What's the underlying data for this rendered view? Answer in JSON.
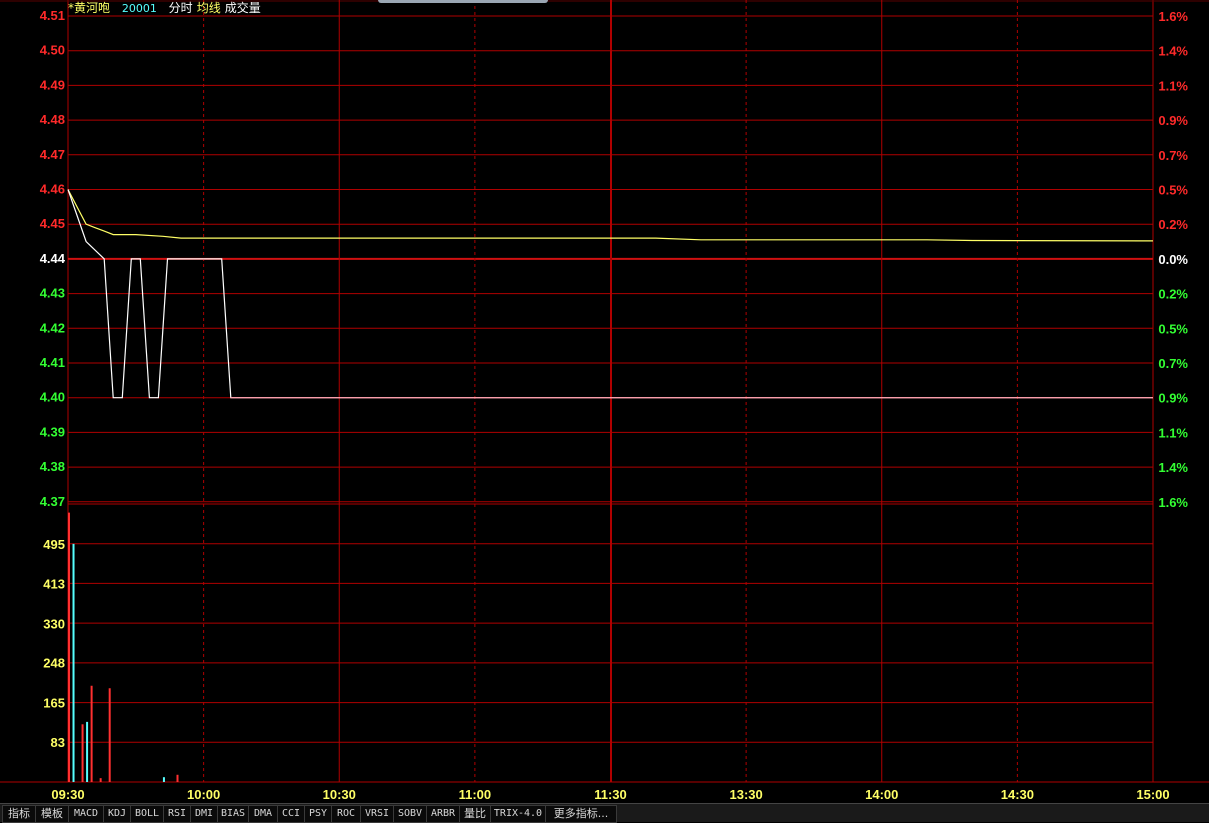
{
  "header": {
    "stock_name": "*黄河咆",
    "code": "20001",
    "legend_minute": "分时",
    "legend_avg": "均线",
    "legend_volume": "成交量"
  },
  "colors": {
    "background": "#000000",
    "grid": "#b00000",
    "up": "#ff2a2a",
    "down": "#33ff33",
    "flat": "#ffffff",
    "price_line": "#ffffff",
    "avg_line": "#ffff66",
    "volume_axis": "#ffff66",
    "vol_up": "#ff3030",
    "vol_down": "#55ffff",
    "time_labels": "#ffff66"
  },
  "tabs": [
    {
      "label": "指标"
    },
    {
      "label": "模板"
    },
    {
      "label": "MACD"
    },
    {
      "label": "KDJ"
    },
    {
      "label": "BOLL"
    },
    {
      "label": "RSI"
    },
    {
      "label": "DMI"
    },
    {
      "label": "BIAS"
    },
    {
      "label": "DMA"
    },
    {
      "label": "CCI"
    },
    {
      "label": "PSY"
    },
    {
      "label": "ROC"
    },
    {
      "label": "VRSI"
    },
    {
      "label": "SOBV"
    },
    {
      "label": "ARBR"
    },
    {
      "label": "量比"
    },
    {
      "label": "TRIX-4.0"
    },
    {
      "label": "更多指标..."
    }
  ],
  "chart_data": {
    "type": "line",
    "prev_close": 4.44,
    "time_ticks": [
      "09:30",
      "10:00",
      "10:30",
      "11:00",
      "11:30",
      "13:30",
      "14:00",
      "14:30",
      "15:00"
    ],
    "price_ticks": [
      {
        "label": "4.51",
        "pct": "1.6%",
        "dir": "up"
      },
      {
        "label": "4.50",
        "pct": "1.4%",
        "dir": "up"
      },
      {
        "label": "4.49",
        "pct": "1.1%",
        "dir": "up"
      },
      {
        "label": "4.48",
        "pct": "0.9%",
        "dir": "up"
      },
      {
        "label": "4.47",
        "pct": "0.7%",
        "dir": "up"
      },
      {
        "label": "4.46",
        "pct": "0.5%",
        "dir": "up"
      },
      {
        "label": "4.45",
        "pct": "0.2%",
        "dir": "up"
      },
      {
        "label": "4.44",
        "pct": "0.0%",
        "dir": "flat"
      },
      {
        "label": "4.43",
        "pct": "0.2%",
        "dir": "down"
      },
      {
        "label": "4.42",
        "pct": "0.5%",
        "dir": "down"
      },
      {
        "label": "4.41",
        "pct": "0.7%",
        "dir": "down"
      },
      {
        "label": "4.40",
        "pct": "0.9%",
        "dir": "down"
      },
      {
        "label": "4.39",
        "pct": "1.1%",
        "dir": "down"
      },
      {
        "label": "4.38",
        "pct": "1.4%",
        "dir": "down"
      },
      {
        "label": "4.37",
        "pct": "1.6%",
        "dir": "down"
      }
    ],
    "price_range": [
      4.37,
      4.51
    ],
    "volume_ticks": [
      "495",
      "413",
      "330",
      "248",
      "165",
      "83"
    ],
    "volume_range": [
      0,
      578
    ],
    "total_minutes": 240,
    "price_series": [
      [
        0,
        4.46
      ],
      [
        4,
        4.445
      ],
      [
        8,
        4.44
      ],
      [
        10,
        4.4
      ],
      [
        12,
        4.4
      ],
      [
        14,
        4.44
      ],
      [
        16,
        4.44
      ],
      [
        18,
        4.4
      ],
      [
        20,
        4.4
      ],
      [
        22,
        4.44
      ],
      [
        34,
        4.44
      ],
      [
        36,
        4.4
      ],
      [
        240,
        4.4
      ]
    ],
    "avg_series": [
      [
        0,
        4.46
      ],
      [
        2,
        4.455
      ],
      [
        4,
        4.45
      ],
      [
        6,
        4.449
      ],
      [
        8,
        4.448
      ],
      [
        10,
        4.447
      ],
      [
        15,
        4.447
      ],
      [
        21,
        4.4465
      ],
      [
        25,
        4.446
      ],
      [
        50,
        4.446
      ],
      [
        130,
        4.446
      ],
      [
        140,
        4.4455
      ],
      [
        190,
        4.4455
      ],
      [
        200,
        4.4453
      ],
      [
        240,
        4.4452
      ]
    ],
    "volume_bars": [
      {
        "t": 0,
        "v": 560,
        "dir": "up"
      },
      {
        "t": 1,
        "v": 495,
        "dir": "down"
      },
      {
        "t": 3,
        "v": 120,
        "dir": "up"
      },
      {
        "t": 4,
        "v": 125,
        "dir": "down"
      },
      {
        "t": 5,
        "v": 200,
        "dir": "up"
      },
      {
        "t": 7,
        "v": 8,
        "dir": "up"
      },
      {
        "t": 9,
        "v": 195,
        "dir": "up"
      },
      {
        "t": 21,
        "v": 10,
        "dir": "down"
      },
      {
        "t": 24,
        "v": 15,
        "dir": "up"
      }
    ]
  }
}
